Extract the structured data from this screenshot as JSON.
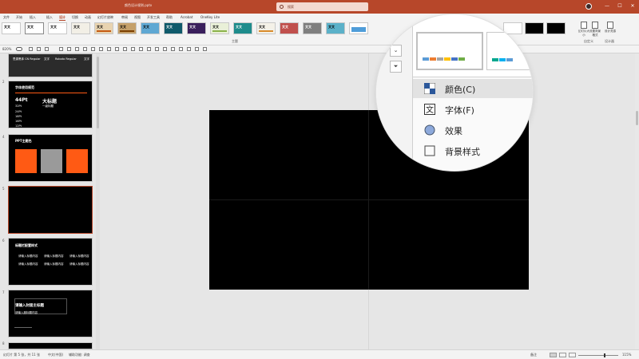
{
  "titlebar": {
    "title": "颜色设计规则.pptx",
    "search_placeholder": "搜索",
    "user": "",
    "buttons": [
      "—",
      "☐",
      "✕"
    ]
  },
  "tabs": [
    "文件",
    "开始",
    "插入",
    "设计",
    "切换",
    "动画",
    "幻灯片放映",
    "审阅",
    "视图",
    "开发工具",
    "帮助",
    "Acrobat",
    "OneKey Lite"
  ],
  "active_tab": 3,
  "share_label": "",
  "comments_label": "",
  "theme_text": "文文",
  "group_labels": {
    "themes": "主题",
    "customize": "自定义",
    "designer": "设计器"
  },
  "ribbon_buttons": [
    "幻灯片大小",
    "设置背景格式",
    "设计灵感"
  ],
  "qat": {
    "zoom": "820%"
  },
  "slides": [
    {
      "num": "1",
      "label_left": "思源黑体 CN Regular",
      "label_mid": "文字",
      "label_right": "Roboto Regular",
      "label_far": "文字"
    },
    {
      "num": "2",
      "title": "字体使用规范",
      "rows": [
        "44Pt",
        "32Pt",
        "24Pt",
        "18Pt",
        "16Pt",
        "12Pt"
      ],
      "headers": [
        "大标题",
        "一级标题"
      ]
    },
    {
      "num": "4",
      "title": "PPT主题色"
    },
    {
      "num": "5"
    },
    {
      "num": "6",
      "title": "标题栏配置样式",
      "items": [
        "请输入标题内容",
        "请输入标题内容",
        "请输入标题内容",
        "请输入标题内容",
        "请输入标题内容",
        "请输入标题内容"
      ]
    },
    {
      "num": "7",
      "title": "请输入封面主标题",
      "sub": "请输入副标题内容"
    },
    {
      "num": "8",
      "title": ""
    }
  ],
  "statusbar": {
    "slide_info": "幻灯片 第 5 张，共 11 张",
    "lang": "中文(中国)",
    "accessibility": "辅助功能: 调查",
    "notes": "备注",
    "zoom": "115%"
  },
  "magnifier": {
    "menu": [
      {
        "label": "颜色(C)",
        "icon": "color-palette-icon"
      },
      {
        "label": "字体(F)",
        "icon": "font-icon"
      },
      {
        "label": "效果",
        "icon": "effects-icon"
      },
      {
        "label": "背景样式",
        "icon": "background-icon"
      }
    ],
    "variant_colors": [
      "#5b9bd5",
      "#ed7d31",
      "#a5a5a5",
      "#ffc000",
      "#4472c4",
      "#70ad47"
    ],
    "variant2_colors": [
      "#00a78e",
      "#00b0f0",
      "#5b9bd5"
    ]
  },
  "colors": {
    "accent": "#b7472a",
    "slide_bg": "#000000",
    "orange": "#ff5a14"
  }
}
